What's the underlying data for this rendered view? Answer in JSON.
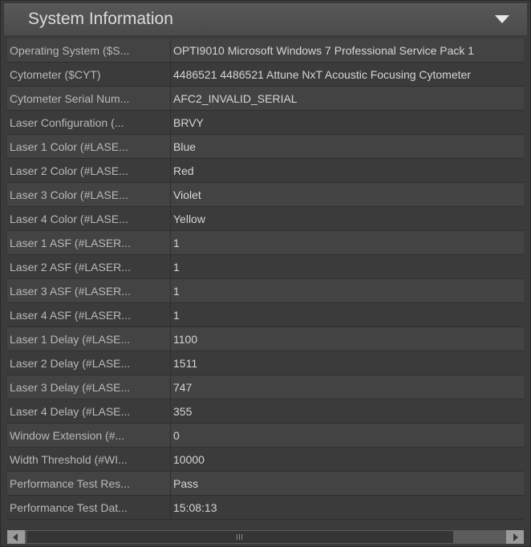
{
  "panel": {
    "title": "System Information",
    "collapse_icon": "chevron-down-icon"
  },
  "colors": {
    "panel_bg": "#3b3b3b",
    "header_bg": "#505050",
    "row_alt_bg": "#434343",
    "text": "#c9c9c9"
  },
  "properties": [
    {
      "name": "Operating System ($S...",
      "value": "OPTI9010 Microsoft Windows 7 Professional Service Pack 1"
    },
    {
      "name": "Cytometer ($CYT)",
      "value": "4486521 4486521 Attune NxT Acoustic Focusing Cytometer"
    },
    {
      "name": "Cytometer Serial Num...",
      "value": "AFC2_INVALID_SERIAL"
    },
    {
      "name": "Laser Configuration (...",
      "value": "BRVY"
    },
    {
      "name": "Laser 1 Color (#LASE...",
      "value": "Blue"
    },
    {
      "name": "Laser 2 Color (#LASE...",
      "value": "Red"
    },
    {
      "name": "Laser 3 Color (#LASE...",
      "value": "Violet"
    },
    {
      "name": "Laser 4 Color (#LASE...",
      "value": "Yellow"
    },
    {
      "name": "Laser 1 ASF (#LASER...",
      "value": "1"
    },
    {
      "name": "Laser 2 ASF (#LASER...",
      "value": "1"
    },
    {
      "name": "Laser 3 ASF (#LASER...",
      "value": "1"
    },
    {
      "name": "Laser 4 ASF (#LASER...",
      "value": "1"
    },
    {
      "name": "Laser 1 Delay (#LASE...",
      "value": "1100"
    },
    {
      "name": "Laser 2 Delay (#LASE...",
      "value": "1511"
    },
    {
      "name": "Laser 3 Delay (#LASE...",
      "value": "747"
    },
    {
      "name": "Laser 4 Delay (#LASE...",
      "value": "355"
    },
    {
      "name": "Window Extension (#...",
      "value": "0"
    },
    {
      "name": "Width Threshold (#WI...",
      "value": "10000"
    },
    {
      "name": "Performance Test Res...",
      "value": "Pass"
    },
    {
      "name": "Performance Test Dat...",
      "value": "15:08:13"
    }
  ],
  "scrollbar": {
    "left_icon": "arrow-left-icon",
    "right_icon": "arrow-right-icon"
  }
}
